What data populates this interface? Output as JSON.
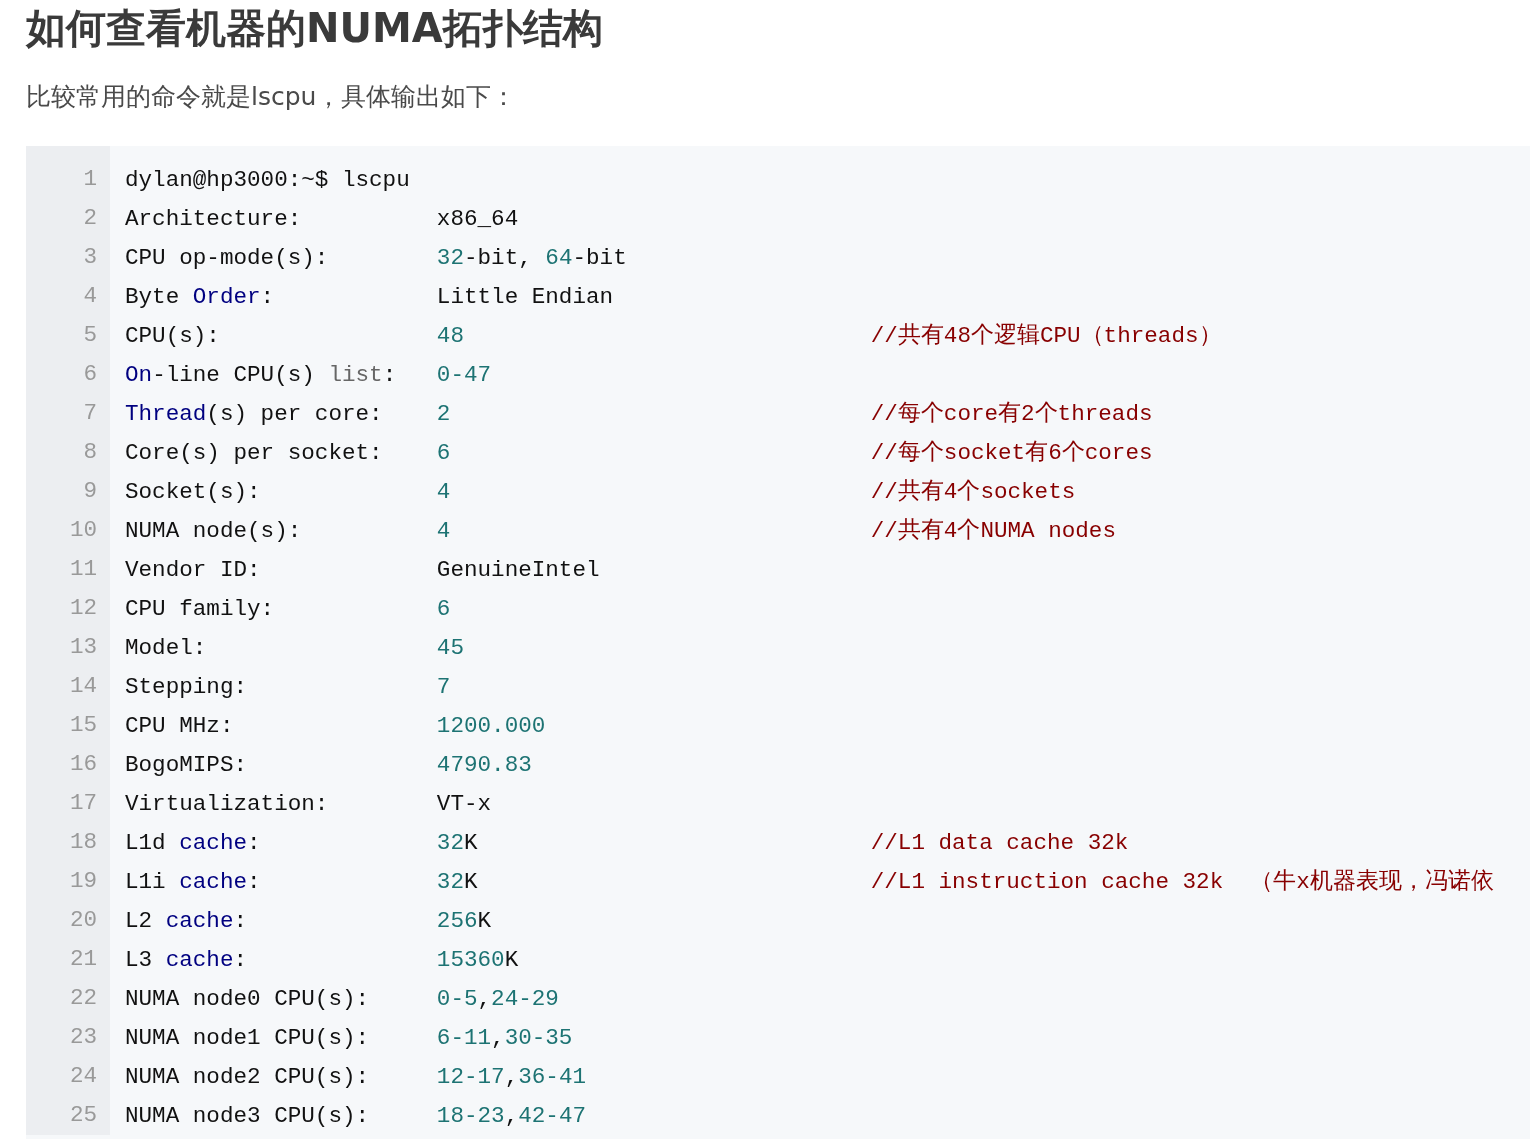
{
  "title": "如何查看机器的NUMA拓扑结构",
  "intro": "比较常用的命令就是lscpu，具体输出如下：",
  "code": {
    "lines": [
      {
        "number": "1",
        "key": [
          {
            "text": "dylan@hp3000:~$ lscpu",
            "kind": "plain"
          }
        ]
      },
      {
        "number": "2",
        "key": [
          {
            "text": "Architecture:",
            "kind": "plain"
          }
        ],
        "value": [
          {
            "text": "x86_64",
            "kind": "plain"
          }
        ]
      },
      {
        "number": "3",
        "key": [
          {
            "text": "CPU op-mode(s):",
            "kind": "plain"
          }
        ],
        "value": [
          {
            "text": "32",
            "kind": "number"
          },
          {
            "text": "-bit, ",
            "kind": "plain"
          },
          {
            "text": "64",
            "kind": "number"
          },
          {
            "text": "-bit",
            "kind": "plain"
          }
        ]
      },
      {
        "number": "4",
        "key": [
          {
            "text": "Byte ",
            "kind": "plain"
          },
          {
            "text": "Order",
            "kind": "keyword"
          },
          {
            "text": ":",
            "kind": "plain"
          }
        ],
        "value": [
          {
            "text": "Little Endian",
            "kind": "plain"
          }
        ]
      },
      {
        "number": "5",
        "key": [
          {
            "text": "CPU(s):",
            "kind": "plain"
          }
        ],
        "value": [
          {
            "text": "48",
            "kind": "number"
          }
        ],
        "comment": "//共有48个逻辑CPU（threads）"
      },
      {
        "number": "6",
        "key": [
          {
            "text": "On",
            "kind": "keyword"
          },
          {
            "text": "-line CPU(s) ",
            "kind": "plain"
          },
          {
            "text": "list",
            "kind": "builtin"
          },
          {
            "text": ":",
            "kind": "plain"
          }
        ],
        "value": [
          {
            "text": "0-47",
            "kind": "number"
          }
        ]
      },
      {
        "number": "7",
        "key": [
          {
            "text": "Thread",
            "kind": "keyword"
          },
          {
            "text": "(s) per core:",
            "kind": "plain"
          }
        ],
        "value": [
          {
            "text": "2",
            "kind": "number"
          }
        ],
        "comment": "//每个core有2个threads"
      },
      {
        "number": "8",
        "key": [
          {
            "text": "Core(s) per socket:",
            "kind": "plain"
          }
        ],
        "value": [
          {
            "text": "6",
            "kind": "number"
          }
        ],
        "comment": "//每个socket有6个cores"
      },
      {
        "number": "9",
        "key": [
          {
            "text": "Socket(s):",
            "kind": "plain"
          }
        ],
        "value": [
          {
            "text": "4",
            "kind": "number"
          }
        ],
        "comment": "//共有4个sockets"
      },
      {
        "number": "10",
        "key": [
          {
            "text": "NUMA node(s):",
            "kind": "plain"
          }
        ],
        "value": [
          {
            "text": "4",
            "kind": "number"
          }
        ],
        "comment": "//共有4个NUMA nodes"
      },
      {
        "number": "11",
        "key": [
          {
            "text": "Vendor ID:",
            "kind": "plain"
          }
        ],
        "value": [
          {
            "text": "GenuineIntel",
            "kind": "plain"
          }
        ]
      },
      {
        "number": "12",
        "key": [
          {
            "text": "CPU family:",
            "kind": "plain"
          }
        ],
        "value": [
          {
            "text": "6",
            "kind": "number"
          }
        ]
      },
      {
        "number": "13",
        "key": [
          {
            "text": "Model:",
            "kind": "plain"
          }
        ],
        "value": [
          {
            "text": "45",
            "kind": "number"
          }
        ]
      },
      {
        "number": "14",
        "key": [
          {
            "text": "Stepping:",
            "kind": "plain"
          }
        ],
        "value": [
          {
            "text": "7",
            "kind": "number"
          }
        ]
      },
      {
        "number": "15",
        "key": [
          {
            "text": "CPU MHz:",
            "kind": "plain"
          }
        ],
        "value": [
          {
            "text": "1200.000",
            "kind": "number"
          }
        ]
      },
      {
        "number": "16",
        "key": [
          {
            "text": "BogoMIPS:",
            "kind": "plain"
          }
        ],
        "value": [
          {
            "text": "4790.83",
            "kind": "number"
          }
        ]
      },
      {
        "number": "17",
        "key": [
          {
            "text": "Virtualization:",
            "kind": "plain"
          }
        ],
        "value": [
          {
            "text": "VT-x",
            "kind": "plain"
          }
        ]
      },
      {
        "number": "18",
        "key": [
          {
            "text": "L1d ",
            "kind": "plain"
          },
          {
            "text": "cache",
            "kind": "keyword"
          },
          {
            "text": ":",
            "kind": "plain"
          }
        ],
        "value": [
          {
            "text": "32",
            "kind": "number"
          },
          {
            "text": "K",
            "kind": "plain"
          }
        ],
        "comment": "//L1 data cache 32k"
      },
      {
        "number": "19",
        "key": [
          {
            "text": "L1i ",
            "kind": "plain"
          },
          {
            "text": "cache",
            "kind": "keyword"
          },
          {
            "text": ":",
            "kind": "plain"
          }
        ],
        "value": [
          {
            "text": "32",
            "kind": "number"
          },
          {
            "text": "K",
            "kind": "plain"
          }
        ],
        "comment": "//L1 instruction cache 32k  （牛x机器表现，冯诺依"
      },
      {
        "number": "20",
        "key": [
          {
            "text": "L2 ",
            "kind": "plain"
          },
          {
            "text": "cache",
            "kind": "keyword"
          },
          {
            "text": ":",
            "kind": "plain"
          }
        ],
        "value": [
          {
            "text": "256",
            "kind": "number"
          },
          {
            "text": "K",
            "kind": "plain"
          }
        ]
      },
      {
        "number": "21",
        "key": [
          {
            "text": "L3 ",
            "kind": "plain"
          },
          {
            "text": "cache",
            "kind": "keyword"
          },
          {
            "text": ":",
            "kind": "plain"
          }
        ],
        "value": [
          {
            "text": "15360",
            "kind": "number"
          },
          {
            "text": "K",
            "kind": "plain"
          }
        ]
      },
      {
        "number": "22",
        "key": [
          {
            "text": "NUMA node0 CPU(s):",
            "kind": "plain"
          }
        ],
        "value": [
          {
            "text": "0-5",
            "kind": "number"
          },
          {
            "text": ",",
            "kind": "plain"
          },
          {
            "text": "24-29",
            "kind": "number"
          }
        ]
      },
      {
        "number": "23",
        "key": [
          {
            "text": "NUMA node1 CPU(s):",
            "kind": "plain"
          }
        ],
        "value": [
          {
            "text": "6-11",
            "kind": "number"
          },
          {
            "text": ",",
            "kind": "plain"
          },
          {
            "text": "30-35",
            "kind": "number"
          }
        ]
      },
      {
        "number": "24",
        "key": [
          {
            "text": "NUMA node2 CPU(s):",
            "kind": "plain"
          }
        ],
        "value": [
          {
            "text": "12-17",
            "kind": "number"
          },
          {
            "text": ",",
            "kind": "plain"
          },
          {
            "text": "36-41",
            "kind": "number"
          }
        ]
      },
      {
        "number": "25",
        "key": [
          {
            "text": "NUMA node3 CPU(s):",
            "kind": "plain"
          }
        ],
        "value": [
          {
            "text": "18-23",
            "kind": "number"
          },
          {
            "text": ",",
            "kind": "plain"
          },
          {
            "text": "42-47",
            "kind": "number"
          }
        ]
      }
    ]
  }
}
